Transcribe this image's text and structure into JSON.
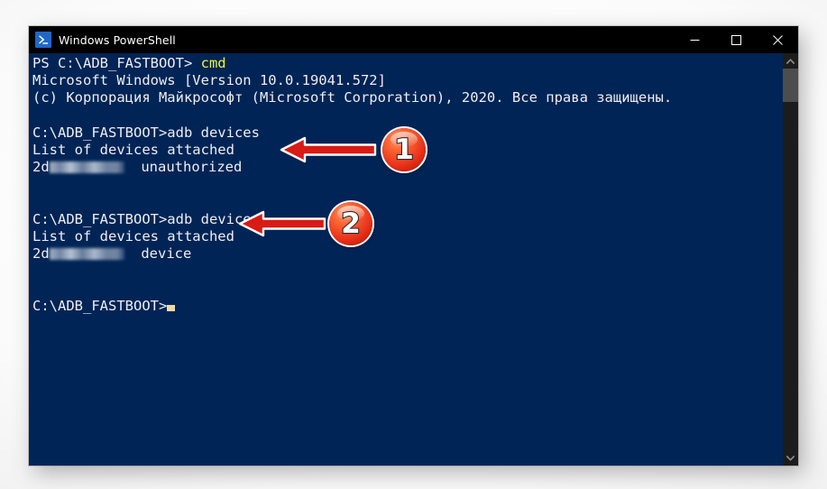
{
  "window": {
    "title": "Windows PowerShell",
    "icon": "powershell-icon",
    "controls": {
      "minimize": "minimize-icon",
      "maximize": "maximize-icon",
      "close": "close-icon"
    },
    "background_color": "#012456",
    "titlebar_color": "#000000"
  },
  "console": {
    "lines": [
      {
        "id": "l1",
        "segments": [
          {
            "text": "PS C:\\ADB_FASTBOOT> ",
            "color": "#eeeeee"
          },
          {
            "text": "cmd",
            "color": "#f3f32c"
          }
        ]
      },
      {
        "id": "l2",
        "segments": [
          {
            "text": "Microsoft Windows [Version 10.0.19041.572]",
            "color": "#eeeeee"
          }
        ]
      },
      {
        "id": "l3",
        "segments": [
          {
            "text": "(c) Корпорация Майкрософт (Microsoft Corporation), 2020. Все права защищены.",
            "color": "#eeeeee"
          }
        ]
      },
      {
        "id": "l4",
        "segments": []
      },
      {
        "id": "l5",
        "segments": [
          {
            "text": "C:\\ADB_FASTBOOT>adb devices",
            "color": "#eeeeee"
          }
        ]
      },
      {
        "id": "l6",
        "segments": [
          {
            "text": "List of devices attached",
            "color": "#eeeeee"
          }
        ]
      },
      {
        "id": "l7",
        "segments": [
          {
            "text": "2d",
            "color": "#eeeeee"
          },
          {
            "redacted": true
          },
          {
            "text": "  unauthorized",
            "color": "#eeeeee"
          }
        ]
      },
      {
        "id": "l8",
        "segments": []
      },
      {
        "id": "l9",
        "segments": []
      },
      {
        "id": "l10",
        "segments": [
          {
            "text": "C:\\ADB_FASTBOOT>adb devices",
            "color": "#eeeeee"
          }
        ]
      },
      {
        "id": "l11",
        "segments": [
          {
            "text": "List of devices attached",
            "color": "#eeeeee"
          }
        ]
      },
      {
        "id": "l12",
        "segments": [
          {
            "text": "2d",
            "color": "#eeeeee"
          },
          {
            "redacted": true
          },
          {
            "text": "  device",
            "color": "#eeeeee"
          }
        ]
      },
      {
        "id": "l13",
        "segments": []
      },
      {
        "id": "l14",
        "segments": []
      },
      {
        "id": "l15",
        "segments": [
          {
            "text": "C:\\ADB_FASTBOOT>",
            "color": "#eeeeee"
          },
          {
            "cursor": true
          }
        ]
      }
    ],
    "prompt_text": "C:\\ADB_FASTBOOT>",
    "command_cmd": "cmd",
    "command_adb_devices": "adb devices",
    "status_unauthorized": "unauthorized",
    "status_device": "device",
    "serial_prefix": "2d",
    "serial_redacted": true
  },
  "scrollbar": {
    "up_arrow": "chevron-up-icon",
    "down_arrow": "chevron-down-icon",
    "thumb_color": "#4d4d4d",
    "track_color": "#1c1c1c"
  },
  "annotations": {
    "accent_color": "#d81b14",
    "callouts": [
      {
        "number": "1",
        "points_to": "unauthorized"
      },
      {
        "number": "2",
        "points_to": "device"
      }
    ]
  }
}
